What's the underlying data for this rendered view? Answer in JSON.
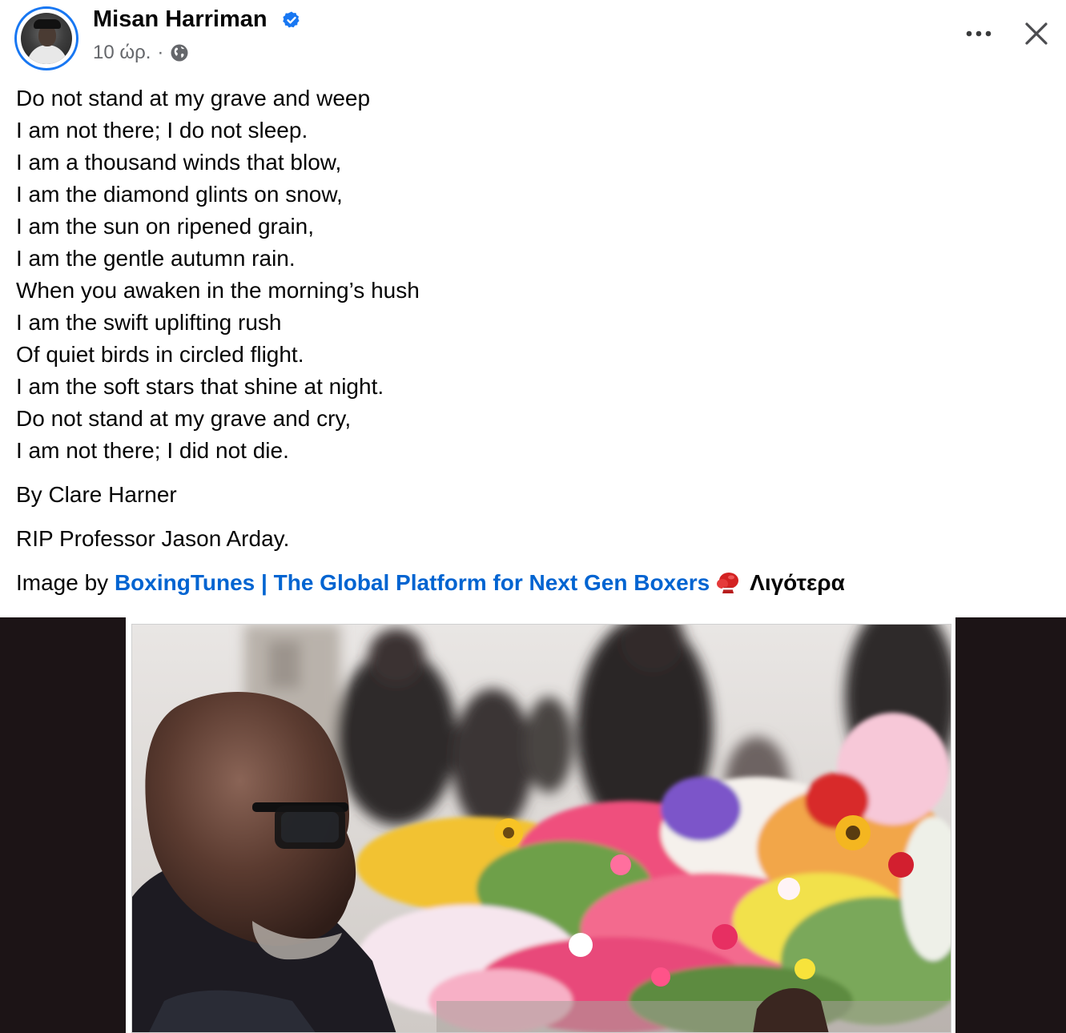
{
  "post": {
    "author": {
      "name": "Misan Harriman",
      "verified": true,
      "time": "10 ώρ.",
      "separator": "·",
      "audience_icon": "globe-icon"
    },
    "header_actions": {
      "more_icon": "more-horizontal-icon",
      "close_icon": "close-icon"
    },
    "poem_lines": [
      "Do not stand at my grave and weep",
      "I am not there; I do not sleep.",
      "I am a thousand winds that blow,",
      "I am the diamond glints on snow,",
      "I am the sun on ripened grain,",
      "I am the gentle autumn rain.",
      "When you awaken in the morning’s hush",
      "I am the swift uplifting rush",
      "Of quiet birds in circled flight.",
      "I am the soft stars that shine at night.",
      "Do not stand at my grave and cry,",
      "I am not there; I did not die."
    ],
    "byline": "By Clare Harner",
    "rip": "RIP Professor Jason Arday.",
    "credit": {
      "prefix": "Image by",
      "link_text": "BoxingTunes | The Global Platform for Next Gen Boxers",
      "emoji_icon": "boxing-glove-icon",
      "see_less": "Λιγότερα"
    },
    "colors": {
      "accent_blue": "#1877f2",
      "link_blue": "#0064d1",
      "secondary_text": "#65676b",
      "media_background": "#1c1416"
    }
  }
}
